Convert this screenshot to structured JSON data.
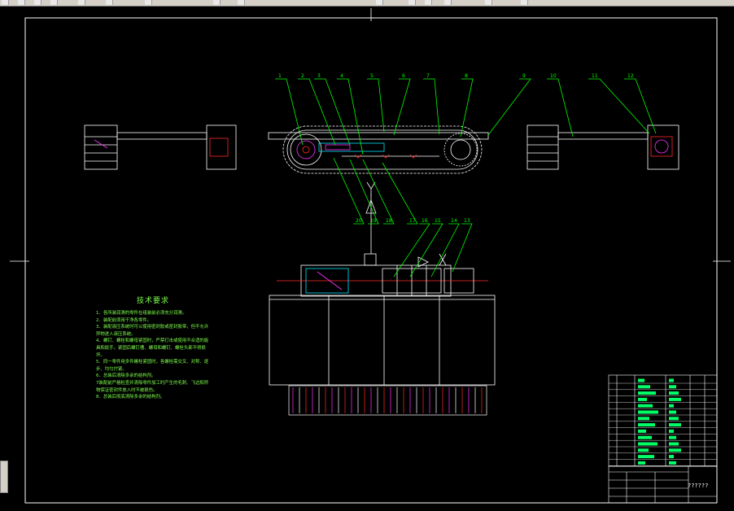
{
  "title_block": {
    "drawing_name": "??????"
  },
  "tech_requirements": {
    "title": "技术要求",
    "notes": [
      "1．各所装润滑的零件在组装前必须充分润滑。",
      "2．装配前须用干净各零件。",
      "3．装配液压系统时可以使用密封胶或密封胶带，但不允许异物进入液压系统。",
      "4．螺钉、螺栓和螺母紧固时，严禁打击或使用不合适的旋具和扳手。紧固后螺钉槽、螺母和螺钉、螺栓头部不得损坏。",
      "5．同一零件用多件螺栓紧固时，各螺栓需交叉、对称、逐步、均匀拧紧。",
      "6．总装后清除多余的结构剂。",
      "7装配前严格检查并清除零件加工时产生的毛刺、飞边和异物保证密封件放入时不被损伤。",
      "8．总装后彻底清除多余的结构剂。"
    ]
  },
  "balloons": {
    "top": [
      "1",
      "2",
      "3",
      "4",
      "5",
      "6",
      "7",
      "8",
      "9",
      "10",
      "11",
      "12"
    ],
    "bottom": [
      "20",
      "19",
      "18",
      "17",
      "16",
      "15",
      "14",
      "13"
    ]
  },
  "colors": {
    "background": "#000000",
    "frame": "#ffffff",
    "leader": "#00ff00",
    "accent_cyan": "#00e5ff",
    "accent_magenta": "#ff33ff",
    "accent_red": "#ff2a2a",
    "note_text": "#7cff4a"
  }
}
